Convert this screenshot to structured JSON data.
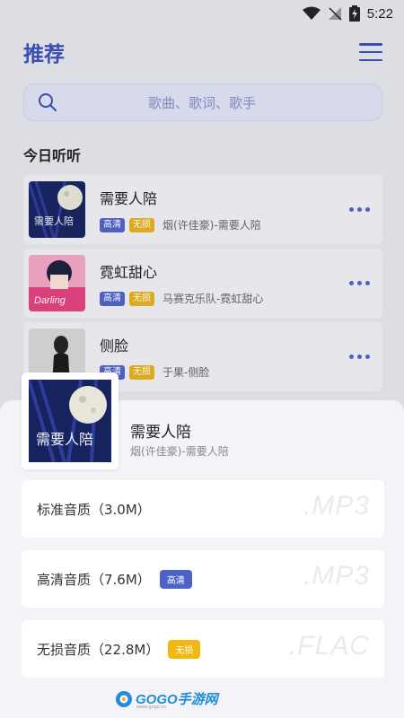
{
  "status_bar": {
    "time": "5:22"
  },
  "header": {
    "title": "推荐"
  },
  "search": {
    "placeholder": "歌曲、歌词、歌手"
  },
  "section": {
    "title": "今日听听"
  },
  "songs": [
    {
      "title": "需要人陪",
      "badges": [
        "高清",
        "无损"
      ],
      "artist": "烟(许佳豪)-需要人陪",
      "cover": "night-moon-cover"
    },
    {
      "title": "霓虹甜心",
      "badges": [
        "高清",
        "无损"
      ],
      "artist": "马赛克乐队-霓虹甜心",
      "cover": "darling-anime-cover"
    },
    {
      "title": "侧脸",
      "badges": [
        "高清",
        "无损"
      ],
      "artist": "于果-侧脸",
      "cover": "girl-portrait-cover"
    }
  ],
  "sheet": {
    "title": "需要人陪",
    "artist": "烟(许佳豪)-需要人陪",
    "options": [
      {
        "label": "标准音质（3.0M）",
        "badge": "",
        "format": ".MP3"
      },
      {
        "label": "高清音质（7.6M）",
        "badge": "高清",
        "format": ".MP3"
      },
      {
        "label": "无损音质（22.8M）",
        "badge": "无损",
        "format": ".FLAC"
      }
    ]
  },
  "watermark": {
    "text": "GOGO手游网",
    "sub": "www.gogo.cn"
  },
  "colors": {
    "accent": "#3a4fb8",
    "hq_badge": "#4e63c8",
    "lossless_badge": "#e6b21d",
    "background": "#e6e6ec",
    "sheet": "#f4f4f8"
  }
}
